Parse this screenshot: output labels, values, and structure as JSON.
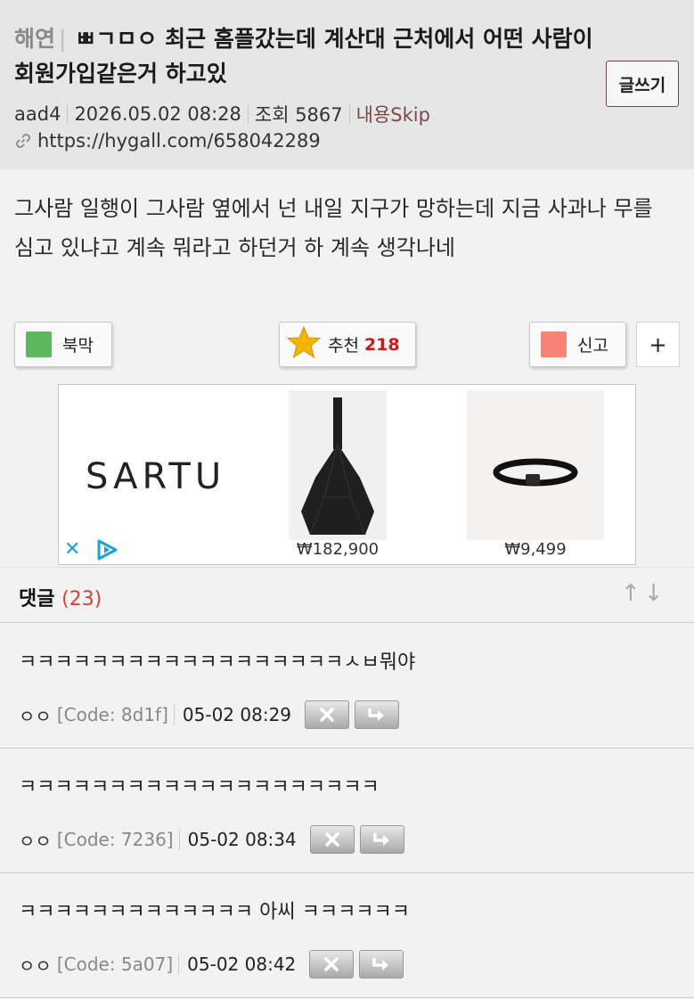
{
  "post": {
    "category": "해연",
    "title": "ㅃㄱㅁㅇ 최근 홈플갔는데 계산대 근처에서 어떤 사람이 회원가입같은거 하고있",
    "write_label": "글쓰기",
    "author": "aad4",
    "date": "2026.05.02 08:28",
    "views_label": "조회 5867",
    "skip_label": "내용Skip",
    "url": "https://hygall.com/658042289",
    "body": "그사람 일행이 그사람 옆에서 넌 내일 지구가 망하는데 지금 사과나 무를 심고 있냐고 계속 뭐라고 하던거 하 계속 생각나네"
  },
  "actions": {
    "bookmark_label": "북막",
    "recommend_label": "추천",
    "recommend_count": "218",
    "report_label": "신고",
    "plus_label": "+"
  },
  "ad": {
    "brand": "SARTU",
    "price1": "₩182,900",
    "price2": "₩9,499",
    "close_label": "✕"
  },
  "comments_header": {
    "label": "댓글",
    "count": "(23)",
    "sort_label": "↑↓"
  },
  "comments": [
    {
      "text": "ㅋㅋㅋㅋㅋㅋㅋㅋㅋㅋㅋㅋㅋㅋㅋㅋㅋㅋㅅㅂ뭐야",
      "nick": "ㅇㅇ",
      "code": "[Code: 8d1f]",
      "time": "05-02 08:29"
    },
    {
      "text": "ㅋㅋㅋㅋㅋㅋㅋㅋㅋㅋㅋㅋㅋㅋㅋㅋㅋㅋㅋㅋ",
      "nick": "ㅇㅇ",
      "code": "[Code: 7236]",
      "time": "05-02 08:34"
    },
    {
      "text": "ㅋㅋㅋㅋㅋㅋㅋㅋㅋㅋㅋㅋㅋ 아씨 ㅋㅋㅋㅋㅋㅋ",
      "nick": "ㅇㅇ",
      "code": "[Code: 5a07]",
      "time": "05-02 08:42"
    }
  ],
  "colors": {
    "header_bg": "#e6e6e6",
    "recommend_count": "#d01818",
    "comment_count": "#d0442e",
    "bookmark": "#5cb85c",
    "report": "#f78276"
  },
  "icons": [
    "link-icon",
    "star-icon",
    "bookmark-square-icon",
    "report-square-icon",
    "ad-close-icon",
    "ad-play-icon",
    "delete-icon",
    "reply-icon",
    "sort-arrows-icon"
  ]
}
